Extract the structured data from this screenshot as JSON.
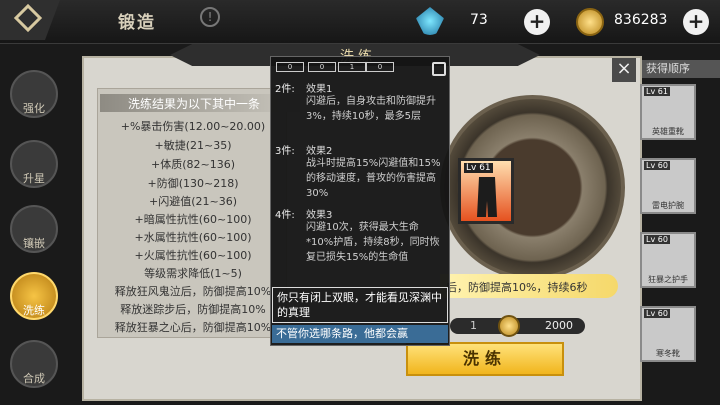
{
  "header": {
    "title": "锻造",
    "help_icon": "info-icon"
  },
  "currency": {
    "gems": "73",
    "gold": "836283",
    "gem_icon": "blue-crystal-icon",
    "gold_icon": "gold-coin-icon"
  },
  "nav": [
    {
      "label": "强化",
      "icon": "hammer-icon",
      "active": false
    },
    {
      "label": "升星",
      "icon": "star-icon",
      "active": false
    },
    {
      "label": "镶嵌",
      "icon": "gem-socket-icon",
      "active": false
    },
    {
      "label": "洗练",
      "icon": "refine-icon",
      "active": true
    },
    {
      "label": "合成",
      "icon": "gear-icon",
      "active": false
    }
  ],
  "panel": {
    "title": "洗练",
    "close_icon": "close-icon"
  },
  "results": {
    "title": "洗练结果为以下其中一条",
    "items": [
      "+%暴击伤害(12.00~20.00)",
      "+敏捷(21~35)",
      "+体质(82~136)",
      "+防御(130~218)",
      "+闪避值(21~36)",
      "+暗属性抗性(60~100)",
      "+水属性抗性(60~100)",
      "+火属性抗性(60~100)",
      "等级需求降低(1~5)",
      "释放狂风鬼泣后，防御提高10%",
      "释放迷踪步后，防御提高10%",
      "释放狂暴之心后，防御提高10%"
    ]
  },
  "item": {
    "level": "Lv 61",
    "icon": "boots-icon"
  },
  "effect_banner": "后，防御提高10%，持续6秒",
  "cost": {
    "count": "1",
    "gold": "2000"
  },
  "refine_button": "洗练",
  "sort_label": "获得顺序",
  "inventory": [
    {
      "level": "Lv 61",
      "label": "英雄重靴"
    },
    {
      "level": "Lv 60",
      "label": "雷电护腕"
    },
    {
      "level": "Lv 60",
      "label": "狂暴之护手"
    },
    {
      "level": "Lv 60",
      "label": "寒冬靴"
    }
  ],
  "tooltip": {
    "slots": [
      "0",
      "0",
      "1",
      "0"
    ],
    "lock_icon": "lock-icon",
    "sets": [
      {
        "count": "2件:",
        "title": "效果1",
        "desc": "闪避后，自身攻击和防御提升3%，持续10秒，最多5层"
      },
      {
        "count": "3件:",
        "title": "效果2",
        "desc": "战斗时提高15%闪避值和15%的移动速度，普攻的伤害提高30%"
      },
      {
        "count": "4件:",
        "title": "效果3",
        "desc": "闪避10次，获得最大生命*10%护盾，持续8秒，同时恢复已损失15%的生命值"
      }
    ],
    "flavor": "你只有闭上双眼，才能看见深渊中的真理",
    "footer": "不管你选哪条路，他都会赢"
  }
}
